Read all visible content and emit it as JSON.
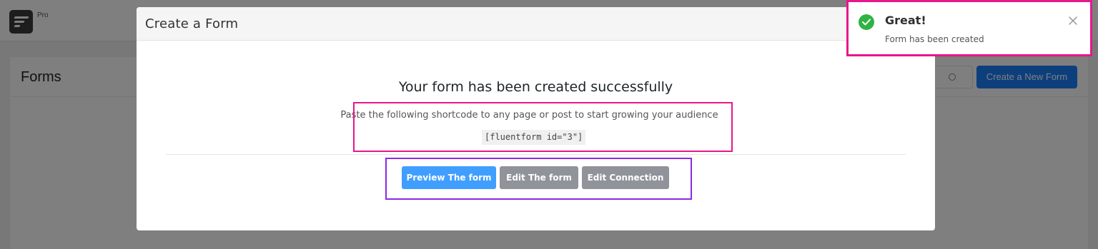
{
  "app": {
    "pro_label": "Pro",
    "page_title": "Forms",
    "create_new_label": "Create a New Form",
    "icons": {
      "logo": "fluentform-logo-icon",
      "search": "search-icon"
    }
  },
  "modal": {
    "title": "Create a Form",
    "success_heading": "Your form has been created successfully",
    "instruction": "Paste the following shortcode to any page or post to start growing your audience",
    "shortcode": "[fluentform id=\"3\"]",
    "buttons": {
      "preview": "Preview The form",
      "edit": "Edit The form",
      "connection": "Edit Connection"
    }
  },
  "notification": {
    "title": "Great!",
    "message": "Form has been created",
    "icons": {
      "status": "check-circle-icon",
      "close": "close-icon"
    },
    "colors": {
      "success": "#2fb344"
    }
  },
  "colors": {
    "primary": "#409eff",
    "secondary": "#909399",
    "highlight_pink": "#e8178a",
    "highlight_purple": "#8a2be2"
  }
}
